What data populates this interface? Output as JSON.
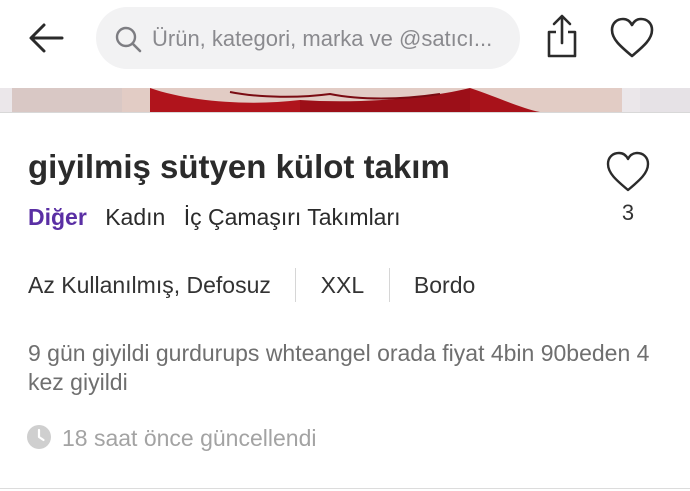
{
  "header": {
    "search_placeholder": "Ürün, kategori, marka ve @satıcı..."
  },
  "product": {
    "title": "giyilmiş sütyen külot takım",
    "like_count": "3",
    "brand": "Diğer",
    "categories": [
      "Kadın",
      "İç Çamaşırı Takımları"
    ],
    "attributes": [
      "Az Kullanılmış, Defosuz",
      "XXL",
      "Bordo"
    ],
    "description": "9 gün giyildi gurdurups whteangel orada fiyat 4bin 90beden 4 kez giyildi",
    "updated": "18 saat önce güncellendi"
  },
  "colors": {
    "brand_link": "#5a2fa4",
    "product_image_accent": "#b0141c"
  },
  "icons": [
    "back-arrow-icon",
    "search-icon",
    "share-icon",
    "heart-icon",
    "clock-icon"
  ]
}
